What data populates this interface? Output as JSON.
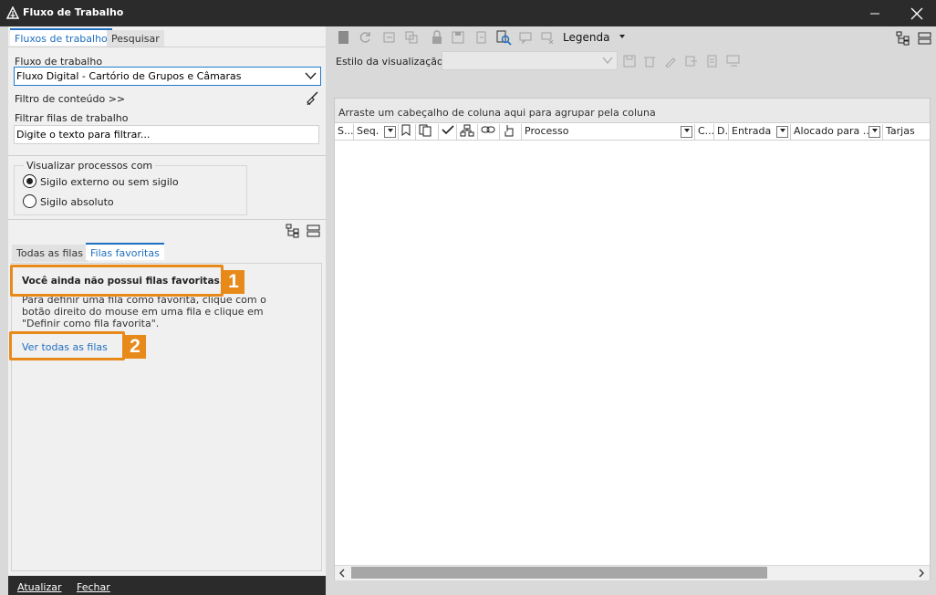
{
  "window": {
    "title": "Fluxo de Trabalho"
  },
  "left_panel": {
    "tabs": [
      "Fluxos de trabalho",
      "Pesquisar"
    ],
    "workflow_label": "Fluxo de trabalho",
    "workflow_value": "Fluxo Digital - Cartório de Grupos e Câmaras",
    "content_filter_label": "Filtro de conteúdo >>",
    "filter_queues_label": "Filtrar filas de trabalho",
    "filter_queues_value": "Digite o texto para filtrar...",
    "visualize_label": "Visualizar processos com",
    "radio_options": [
      "Sigilo externo ou sem sigilo",
      "Sigilo absoluto"
    ],
    "radio_selected": 0,
    "queue_tabs": [
      "Todas as filas",
      "Filas favoritas"
    ],
    "no_favorites_title": "Você ainda não possui filas favoritas.",
    "no_favorites_help": "Para definir uma fila como favorita, clique com o botão direito do mouse em uma fila e clique em \"Definir como fila favorita\".",
    "see_all_link": "Ver todas as filas",
    "footer_buttons": [
      "Atualizar",
      "Fechar"
    ]
  },
  "annotations": {
    "badge1": "1",
    "badge2": "2"
  },
  "toolbar": {
    "legend_label": "Legenda",
    "view_style_label": "Estilo da visualização",
    "view_style_value": ""
  },
  "grid": {
    "group_hint": "Arraste um cabeçalho de coluna aqui para agrupar pela coluna",
    "columns": [
      "S...",
      "Seq.",
      "Processo",
      "C...",
      "D...",
      "Entrada",
      "Alocado para ...",
      "Tarjas"
    ]
  },
  "colors": {
    "accent": "#1f6fbf",
    "highlight": "#e88a1a",
    "titlebar": "#2b2b2b"
  }
}
